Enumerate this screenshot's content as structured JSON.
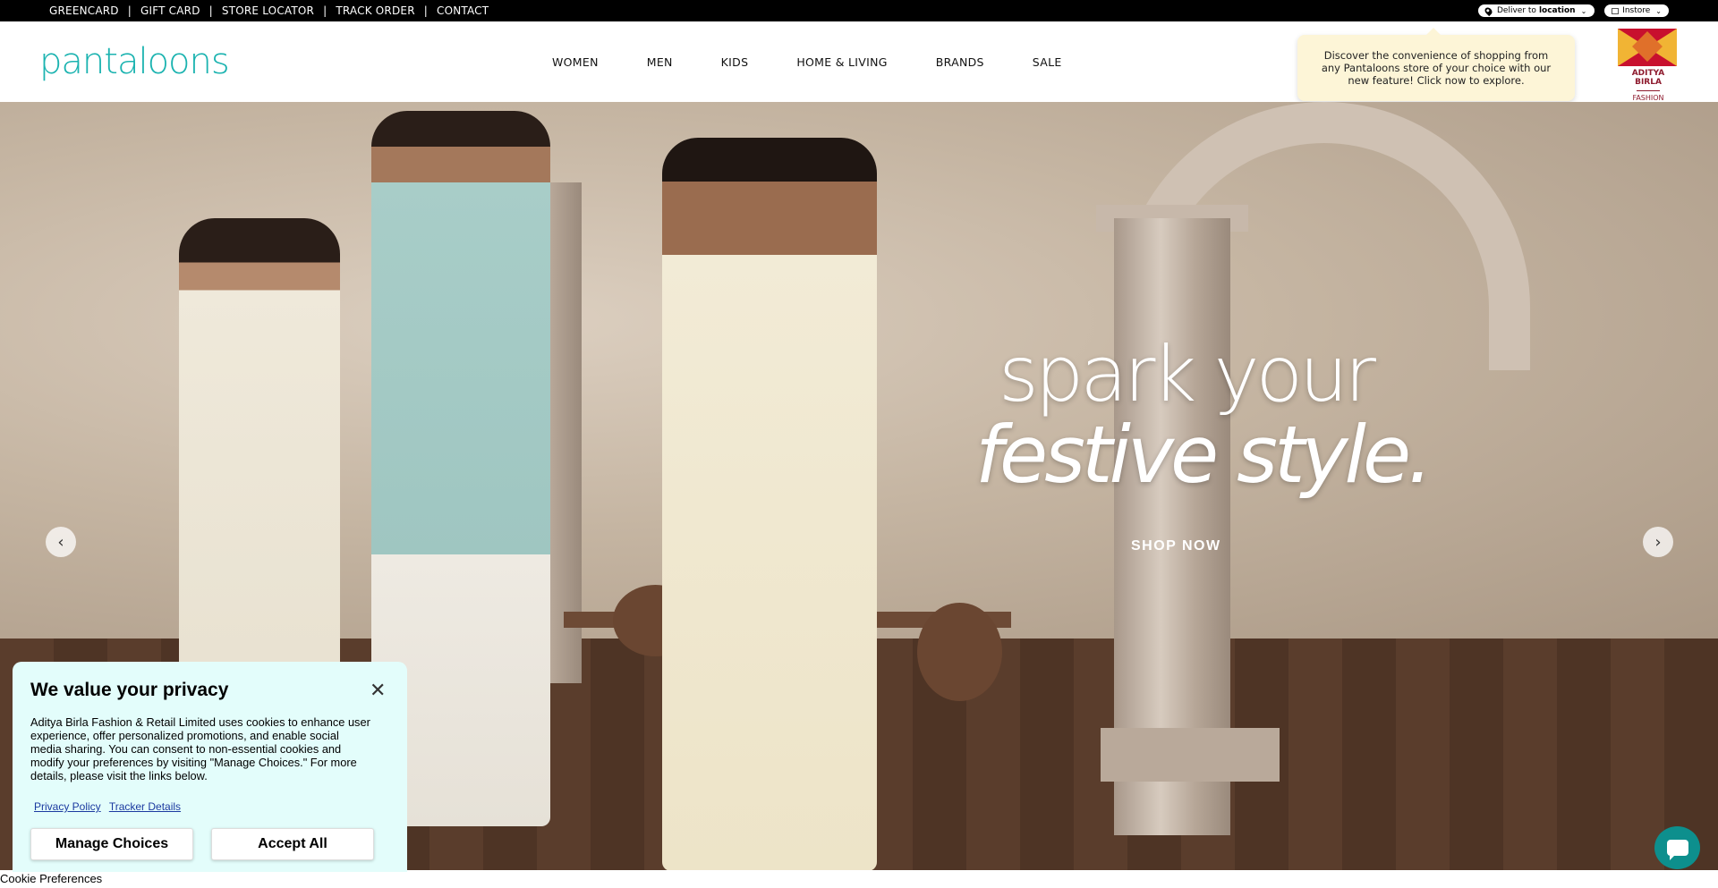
{
  "utility_bar": {
    "links": [
      "GREENCARD",
      "GIFT CARD",
      "STORE LOCATOR",
      "TRACK ORDER",
      "CONTACT"
    ],
    "separator": "|",
    "deliver_prefix": "Deliver to",
    "deliver_location": "location",
    "instore_label": "Instore"
  },
  "header": {
    "logo_text": "pantaloons",
    "nav": [
      "WOMEN",
      "MEN",
      "KIDS",
      "HOME & LIVING",
      "BRANDS",
      "SALE"
    ],
    "tooltip": "Discover the convenience of shopping from any Pantaloons store of your choice with our new feature! Click now to explore.",
    "partner_logo": {
      "line1": "ADITYA BIRLA",
      "line2": "FASHION"
    }
  },
  "hero": {
    "headline_line1": "spark your",
    "headline_line2": "festive style.",
    "cta": "SHOP NOW",
    "prev_icon": "‹",
    "next_icon": "›"
  },
  "cookie_banner": {
    "title": "We value your privacy",
    "close_icon": "✕",
    "body": "Aditya Birla Fashion & Retail Limited uses cookies to enhance user experience, offer personalized promotions, and enable social media sharing. You can consent to non-essential cookies and modify your preferences by visiting \"Manage Choices.\" For more details, please visit the links below.",
    "privacy_link": "Privacy Policy",
    "tracker_link": "Tracker Details",
    "manage_button": "Manage Choices",
    "accept_button": "Accept All"
  },
  "cookie_preferences_label": "Cookie Preferences",
  "colors": {
    "brand_teal": "#1bb3b0",
    "topbar_bg": "#000000",
    "cookie_bg": "#e3fdfb",
    "tooltip_bg": "#fdf5d7",
    "chat_bg": "#0d8f8d"
  }
}
